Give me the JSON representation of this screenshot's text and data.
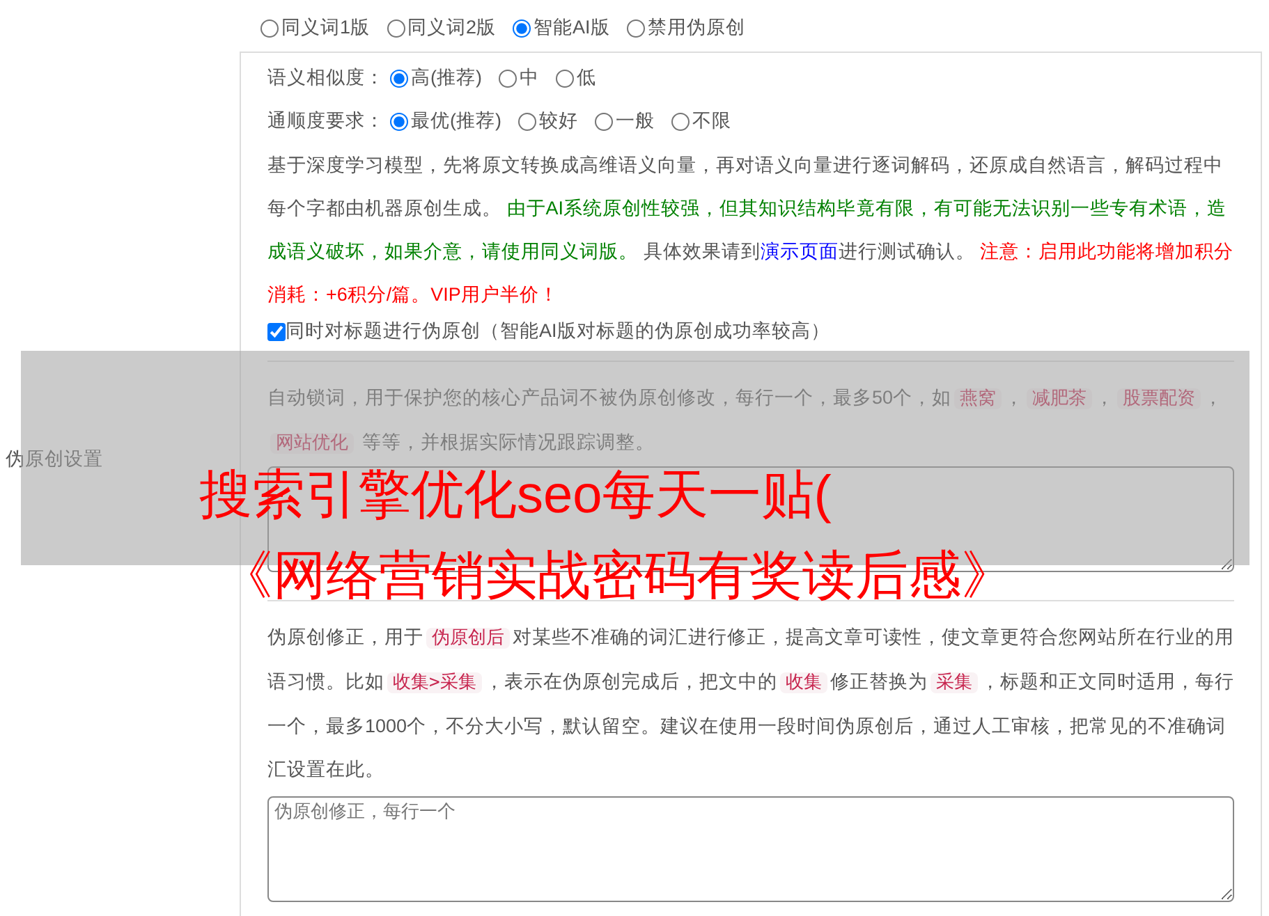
{
  "section_label": "伪原创设置",
  "modes": [
    {
      "label": "同义词1版",
      "selected": false
    },
    {
      "label": "同义词2版",
      "selected": false
    },
    {
      "label": "智能AI版",
      "selected": true
    },
    {
      "label": "禁用伪原创",
      "selected": false
    }
  ],
  "ai_options": [
    {
      "label": "语义相似度：",
      "choices": [
        {
          "label": "高(推荐)",
          "selected": true
        },
        {
          "label": "中",
          "selected": false
        },
        {
          "label": "低",
          "selected": false
        }
      ]
    },
    {
      "label": "通顺度要求：",
      "choices": [
        {
          "label": "最优(推荐)",
          "selected": true
        },
        {
          "label": "较好",
          "selected": false
        },
        {
          "label": "一般",
          "selected": false
        },
        {
          "label": "不限",
          "selected": false
        }
      ]
    }
  ],
  "ai_description": [
    {
      "kind": "text",
      "text": "基于深度学习模型，先将原文转换成高维语义向量，再对语义向量进行逐词解码，还原成自然语言，解码过程中每个字都由机器原创生成。 "
    },
    {
      "kind": "green",
      "text": "由于AI系统原创性较强，但其知识结构毕竟有限，有可能无法识别一些专有术语，造成语义破坏，如果介意，请使用同义词版。"
    },
    {
      "kind": "text",
      "text": " 具体效果请到"
    },
    {
      "kind": "link",
      "text": "演示页面"
    },
    {
      "kind": "text",
      "text": "进行测试确认。 "
    },
    {
      "kind": "red",
      "text": "注意：启用此功能将增加积分消耗：+6积分/篇。VIP用户半价！"
    }
  ],
  "title_option": {
    "label": "同时对标题进行伪原创（智能AI版对标题的伪原创成功率较高）",
    "checked": true
  },
  "lock_words": {
    "description": [
      {
        "kind": "text",
        "text": "自动锁词，用于保护您的核心产品词不被伪原创修改，每行一个，最多50个，如"
      },
      {
        "kind": "code",
        "text": "燕窝"
      },
      {
        "kind": "text",
        "text": "，"
      },
      {
        "kind": "code",
        "text": "减肥茶"
      },
      {
        "kind": "text",
        "text": "，"
      },
      {
        "kind": "code",
        "text": "股票配资"
      },
      {
        "kind": "text",
        "text": "，"
      },
      {
        "kind": "code",
        "text": "网站优化"
      },
      {
        "kind": "text",
        "text": " 等等，并根据实际情况跟踪调整。"
      }
    ]
  },
  "corrections": {
    "description": [
      {
        "kind": "text",
        "text": "伪原创修正，用于"
      },
      {
        "kind": "code",
        "text": "伪原创后"
      },
      {
        "kind": "text",
        "text": "对某些不准确的词汇进行修正，提高文章可读性，使文章更符合您网站所在行业的用语习惯。比如"
      },
      {
        "kind": "code",
        "text": "收集>采集"
      },
      {
        "kind": "text",
        "text": "，表示在伪原创完成后，把文中的"
      },
      {
        "kind": "code",
        "text": "收集"
      },
      {
        "kind": "text",
        "text": "修正替换为"
      },
      {
        "kind": "code",
        "text": "采集"
      },
      {
        "kind": "text",
        "text": "，标题和正文同时适用，每行一个，最多1000个，不分大小写，默认留空。建议在使用一段时间伪原创后，通过人工审核，把常见的不准确词汇设置在此。"
      }
    ],
    "placeholder": "伪原创修正，每行一个"
  },
  "banner": {
    "lines": [
      "搜索引擎优化seo每天一贴(",
      "《网络营销实战密码有奖读后感》"
    ]
  }
}
